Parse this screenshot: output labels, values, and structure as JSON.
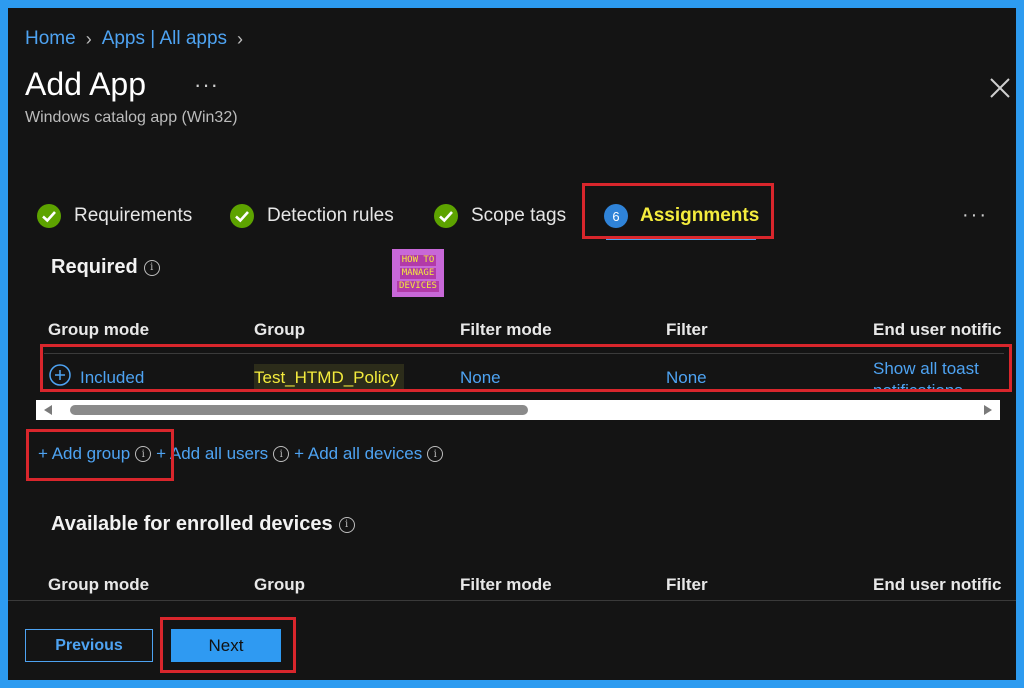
{
  "breadcrumb": {
    "home": "Home",
    "apps": "Apps | All apps"
  },
  "header": {
    "title": "Add App",
    "more": "···",
    "subtitle": "Windows catalog app (Win32)"
  },
  "tabs": [
    {
      "label": "Requirements",
      "state": "complete"
    },
    {
      "label": "Detection rules",
      "state": "complete"
    },
    {
      "label": "Scope tags",
      "state": "complete"
    },
    {
      "label": "Assignments",
      "state": "active",
      "step": "6"
    }
  ],
  "tabs_more": "···",
  "logo": {
    "line1": "HOW TO",
    "line2": "MANAGE",
    "line3": "DEVICES"
  },
  "required": {
    "title": "Required",
    "columns": [
      "Group mode",
      "Group",
      "Filter mode",
      "Filter",
      "End user notific"
    ],
    "row": {
      "group_mode": "Included",
      "group": "Test_HTMD_Policy",
      "filter_mode": "None",
      "filter": "None",
      "notification_line1": "Show all toast",
      "notification_line2": "notifications"
    },
    "links": {
      "add_group": "+ Add group",
      "add_all_users": "+ Add all users",
      "add_all_devices": "+ Add all devices"
    }
  },
  "available": {
    "title": "Available for enrolled devices",
    "columns": [
      "Group mode",
      "Group",
      "Filter mode",
      "Filter",
      "End user notific"
    ]
  },
  "footer": {
    "previous": "Previous",
    "next": "Next"
  },
  "colors": {
    "accent": "#2f9af2",
    "highlight": "#d9262c",
    "check": "#5da300",
    "active_tab": "#f4ec3d",
    "frame_border": "#2d9bf0"
  }
}
